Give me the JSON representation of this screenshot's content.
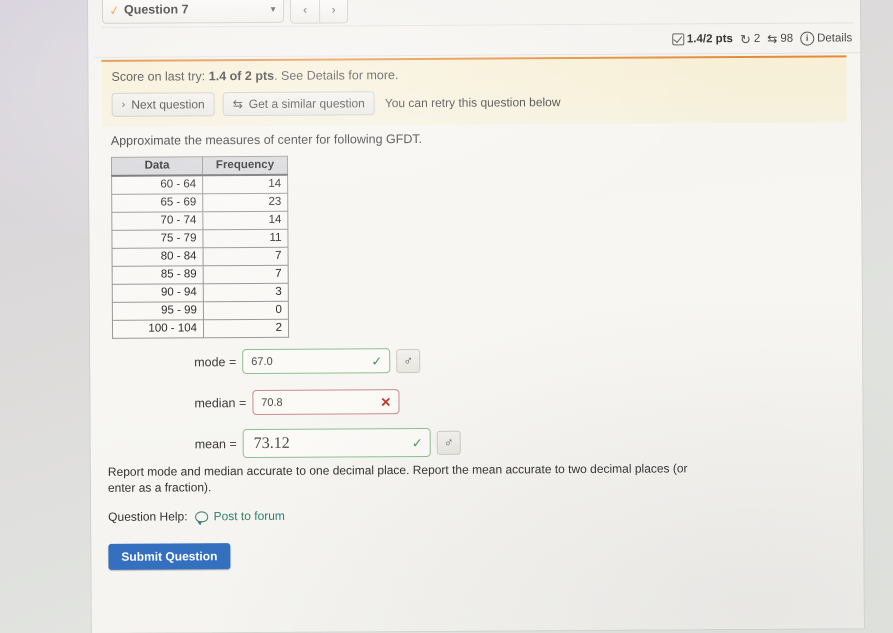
{
  "header": {
    "question_selector_label": "Question 7",
    "selector_check_icon": "check-icon",
    "caret_icon": "chevron-down-icon",
    "prev_label": "‹",
    "next_label": "›",
    "cut_widget_count": "10"
  },
  "meta": {
    "points": "1.4/2 pts",
    "attempts": "2",
    "similar_count": "98",
    "details_label": "Details",
    "checkbox_icon": "checkbox-check-icon",
    "retry_icon": "circular-arrow-icon",
    "swap_icon": "swap-arrows-icon",
    "info_icon": "info-circle-icon"
  },
  "banner": {
    "score_prefix": "Score on last try:",
    "score_value": "1.4 of 2 pts",
    "score_suffix": ". See Details for more.",
    "next_question_label": "Next question",
    "similar_question_label": "Get a similar question",
    "retry_note": "You can retry this question below",
    "accent_color": "#e58b36",
    "background_color": "#f7efd6"
  },
  "question": {
    "prompt": "Approximate the measures of center for following GFDT.",
    "note": "Report mode and median accurate to one decimal place. Report the mean accurate to two decimal places (or enter as a fraction).",
    "help_label": "Question Help:",
    "post_to_forum_label": "Post to forum",
    "post_link_color": "#2f7f6f",
    "submit_label": "Submit Question",
    "submit_color": "#3470bf"
  },
  "table": {
    "headers": [
      "Data",
      "Frequency"
    ],
    "rows": [
      {
        "data": "60 - 64",
        "frequency": "14"
      },
      {
        "data": "65 - 69",
        "frequency": "23"
      },
      {
        "data": "70 - 74",
        "frequency": "14"
      },
      {
        "data": "75 - 79",
        "frequency": "11"
      },
      {
        "data": "80 - 84",
        "frequency": "7"
      },
      {
        "data": "85 - 89",
        "frequency": "7"
      },
      {
        "data": "90 - 94",
        "frequency": "3"
      },
      {
        "data": "95 - 99",
        "frequency": "0"
      },
      {
        "data": "100 - 104",
        "frequency": "2"
      }
    ]
  },
  "answers": [
    {
      "label": "mode =",
      "value": "67.0",
      "status": "correct",
      "mark": "✓",
      "tool_icon": "♂",
      "tool_icon_name": "sigma-tool-icon"
    },
    {
      "label": "median =",
      "value": "70.8",
      "status": "incorrect",
      "mark": "✕",
      "tool_icon": "",
      "tool_icon_name": ""
    },
    {
      "label": "mean =",
      "value": "73.12",
      "status": "correct",
      "mark": "✓",
      "tool_icon": "♂",
      "tool_icon_name": "sigma-tool-icon"
    }
  ]
}
